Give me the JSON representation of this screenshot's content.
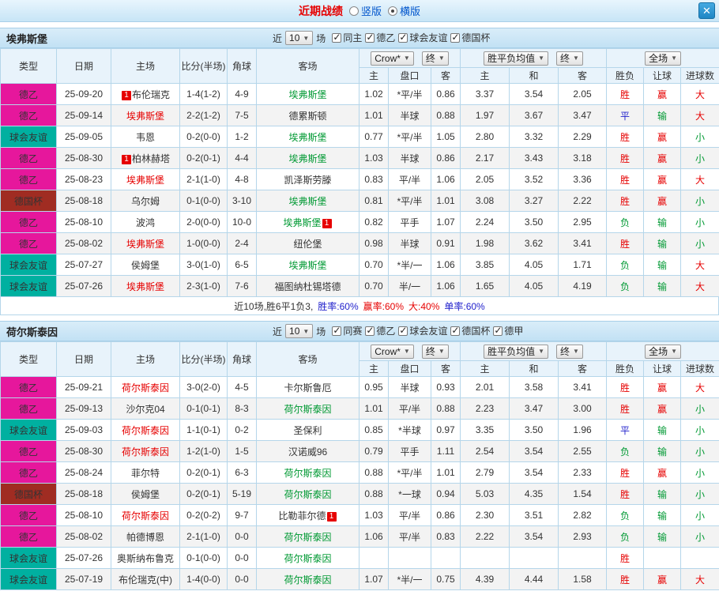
{
  "topbar": {
    "title": "近期战绩",
    "options": [
      {
        "label": "竖版",
        "selected": false
      },
      {
        "label": "横版",
        "selected": true
      }
    ],
    "close": "✕"
  },
  "filters": {
    "near": "近",
    "count": "10",
    "unit": "场",
    "company": "Crow*",
    "final": "终",
    "avg": "胜平负均值",
    "scope": "全场"
  },
  "table_header": {
    "type": "类型",
    "date": "日期",
    "home": "主场",
    "score": "比分(半场)",
    "corner": "角球",
    "away": "客场",
    "odds_home": "主",
    "odds_handicap": "盘口",
    "odds_away": "客",
    "avg_home": "主",
    "avg_draw": "和",
    "avg_away": "客",
    "result": "胜负",
    "handicap": "让球",
    "goals": "进球数"
  },
  "league_colors": {
    "德乙": "#e6179c",
    "球会友谊": "#00b0a0",
    "德国杯": "#a02c22"
  },
  "result_colors": {
    "red": "#e60000",
    "green": "#009933",
    "blue": "#2222cc"
  },
  "sections": [
    {
      "team": "埃弗斯堡",
      "checkboxes": [
        {
          "label": "同主",
          "checked": true
        },
        {
          "label": "德乙",
          "checked": true
        },
        {
          "label": "球会友谊",
          "checked": true
        },
        {
          "label": "德国杯",
          "checked": true
        }
      ],
      "rows": [
        {
          "league": "德乙",
          "date": "25-09-20",
          "home": {
            "name": "布伦瑞克",
            "badge": "1",
            "badge_pos": "before"
          },
          "score": "1-4(1-2)",
          "corner": "4-9",
          "away": {
            "name": "埃弗斯堡",
            "cls": "green"
          },
          "odds": [
            "1.02",
            "*平/半",
            "0.86",
            "3.37",
            "3.54",
            "2.05"
          ],
          "results": [
            {
              "t": "胜",
              "c": "red"
            },
            {
              "t": "赢",
              "c": "red"
            },
            {
              "t": "大",
              "c": "red"
            }
          ]
        },
        {
          "league": "德乙",
          "date": "25-09-14",
          "home": {
            "name": "埃弗斯堡",
            "cls": "red"
          },
          "score": "2-2(1-2)",
          "corner": "7-5",
          "away": {
            "name": "德累斯顿"
          },
          "odds": [
            "1.01",
            "半球",
            "0.88",
            "1.97",
            "3.67",
            "3.47"
          ],
          "results": [
            {
              "t": "平",
              "c": "blue"
            },
            {
              "t": "输",
              "c": "green"
            },
            {
              "t": "大",
              "c": "red"
            }
          ]
        },
        {
          "league": "球会友谊",
          "date": "25-09-05",
          "home": {
            "name": "韦恩"
          },
          "score": "0-2(0-0)",
          "corner": "1-2",
          "away": {
            "name": "埃弗斯堡",
            "cls": "green"
          },
          "odds": [
            "0.77",
            "*平/半",
            "1.05",
            "2.80",
            "3.32",
            "2.29"
          ],
          "results": [
            {
              "t": "胜",
              "c": "red"
            },
            {
              "t": "赢",
              "c": "red"
            },
            {
              "t": "小",
              "c": "green"
            }
          ]
        },
        {
          "league": "德乙",
          "date": "25-08-30",
          "home": {
            "name": "柏林赫塔",
            "badge": "1",
            "badge_pos": "before"
          },
          "score": "0-2(0-1)",
          "corner": "4-4",
          "away": {
            "name": "埃弗斯堡",
            "cls": "green"
          },
          "odds": [
            "1.03",
            "半球",
            "0.86",
            "2.17",
            "3.43",
            "3.18"
          ],
          "results": [
            {
              "t": "胜",
              "c": "red"
            },
            {
              "t": "赢",
              "c": "red"
            },
            {
              "t": "小",
              "c": "green"
            }
          ]
        },
        {
          "league": "德乙",
          "date": "25-08-23",
          "home": {
            "name": "埃弗斯堡",
            "cls": "red"
          },
          "score": "2-1(1-0)",
          "corner": "4-8",
          "away": {
            "name": "凯泽斯劳滕"
          },
          "odds": [
            "0.83",
            "平/半",
            "1.06",
            "2.05",
            "3.52",
            "3.36"
          ],
          "results": [
            {
              "t": "胜",
              "c": "red"
            },
            {
              "t": "赢",
              "c": "red"
            },
            {
              "t": "大",
              "c": "red"
            }
          ]
        },
        {
          "league": "德国杯",
          "date": "25-08-18",
          "home": {
            "name": "乌尔姆"
          },
          "score": "0-1(0-0)",
          "corner": "3-10",
          "away": {
            "name": "埃弗斯堡",
            "cls": "green"
          },
          "odds": [
            "0.81",
            "*平/半",
            "1.01",
            "3.08",
            "3.27",
            "2.22"
          ],
          "results": [
            {
              "t": "胜",
              "c": "red"
            },
            {
              "t": "赢",
              "c": "red"
            },
            {
              "t": "小",
              "c": "green"
            }
          ]
        },
        {
          "league": "德乙",
          "date": "25-08-10",
          "home": {
            "name": "波鸿"
          },
          "score": "2-0(0-0)",
          "corner": "10-0",
          "away": {
            "name": "埃弗斯堡",
            "cls": "green",
            "badge": "1",
            "badge_pos": "after"
          },
          "odds": [
            "0.82",
            "平手",
            "1.07",
            "2.24",
            "3.50",
            "2.95"
          ],
          "results": [
            {
              "t": "负",
              "c": "green"
            },
            {
              "t": "输",
              "c": "green"
            },
            {
              "t": "小",
              "c": "green"
            }
          ]
        },
        {
          "league": "德乙",
          "date": "25-08-02",
          "home": {
            "name": "埃弗斯堡",
            "cls": "red"
          },
          "score": "1-0(0-0)",
          "corner": "2-4",
          "away": {
            "name": "纽伦堡"
          },
          "odds": [
            "0.98",
            "半球",
            "0.91",
            "1.98",
            "3.62",
            "3.41"
          ],
          "results": [
            {
              "t": "胜",
              "c": "red"
            },
            {
              "t": "输",
              "c": "green"
            },
            {
              "t": "小",
              "c": "green"
            }
          ]
        },
        {
          "league": "球会友谊",
          "date": "25-07-27",
          "home": {
            "name": "侯姆堡"
          },
          "score": "3-0(1-0)",
          "corner": "6-5",
          "away": {
            "name": "埃弗斯堡",
            "cls": "green"
          },
          "odds": [
            "0.70",
            "*半/一",
            "1.06",
            "3.85",
            "4.05",
            "1.71"
          ],
          "results": [
            {
              "t": "负",
              "c": "green"
            },
            {
              "t": "输",
              "c": "green"
            },
            {
              "t": "大",
              "c": "red"
            }
          ]
        },
        {
          "league": "球会友谊",
          "date": "25-07-26",
          "home": {
            "name": "埃弗斯堡",
            "cls": "red"
          },
          "score": "2-3(1-0)",
          "corner": "7-6",
          "away": {
            "name": "福图纳杜锡塔德"
          },
          "odds": [
            "0.70",
            "半/一",
            "1.06",
            "1.65",
            "4.05",
            "4.19"
          ],
          "results": [
            {
              "t": "负",
              "c": "green"
            },
            {
              "t": "输",
              "c": "green"
            },
            {
              "t": "大",
              "c": "red"
            }
          ]
        }
      ],
      "summary": [
        {
          "t": "近10场,胜6平1负3,",
          "c": "#333333"
        },
        {
          "t": "胜率:60%",
          "c": "#2222cc"
        },
        {
          "t": "赢率:60%",
          "c": "#e60000"
        },
        {
          "t": "大:40%",
          "c": "#e60000"
        },
        {
          "t": "单率:60%",
          "c": "#2222cc"
        }
      ]
    },
    {
      "team": "荷尔斯泰因",
      "checkboxes": [
        {
          "label": "同赛",
          "checked": true
        },
        {
          "label": "德乙",
          "checked": true
        },
        {
          "label": "球会友谊",
          "checked": true
        },
        {
          "label": "德国杯",
          "checked": true
        },
        {
          "label": "德甲",
          "checked": true
        }
      ],
      "rows": [
        {
          "league": "德乙",
          "date": "25-09-21",
          "home": {
            "name": "荷尔斯泰因",
            "cls": "red"
          },
          "score": "3-0(2-0)",
          "corner": "4-5",
          "away": {
            "name": "卡尔斯鲁厄"
          },
          "odds": [
            "0.95",
            "半球",
            "0.93",
            "2.01",
            "3.58",
            "3.41"
          ],
          "results": [
            {
              "t": "胜",
              "c": "red"
            },
            {
              "t": "赢",
              "c": "red"
            },
            {
              "t": "大",
              "c": "red"
            }
          ]
        },
        {
          "league": "德乙",
          "date": "25-09-13",
          "home": {
            "name": "沙尔克04"
          },
          "score": "0-1(0-1)",
          "corner": "8-3",
          "away": {
            "name": "荷尔斯泰因",
            "cls": "green"
          },
          "odds": [
            "1.01",
            "平/半",
            "0.88",
            "2.23",
            "3.47",
            "3.00"
          ],
          "results": [
            {
              "t": "胜",
              "c": "red"
            },
            {
              "t": "赢",
              "c": "red"
            },
            {
              "t": "小",
              "c": "green"
            }
          ]
        },
        {
          "league": "球会友谊",
          "date": "25-09-03",
          "home": {
            "name": "荷尔斯泰因",
            "cls": "red"
          },
          "score": "1-1(0-1)",
          "corner": "0-2",
          "away": {
            "name": "圣保利"
          },
          "odds": [
            "0.85",
            "*半球",
            "0.97",
            "3.35",
            "3.50",
            "1.96"
          ],
          "results": [
            {
              "t": "平",
              "c": "blue"
            },
            {
              "t": "输",
              "c": "green"
            },
            {
              "t": "小",
              "c": "green"
            }
          ]
        },
        {
          "league": "德乙",
          "date": "25-08-30",
          "home": {
            "name": "荷尔斯泰因",
            "cls": "red"
          },
          "score": "1-2(1-0)",
          "corner": "1-5",
          "away": {
            "name": "汉诺威96"
          },
          "odds": [
            "0.79",
            "平手",
            "1.11",
            "2.54",
            "3.54",
            "2.55"
          ],
          "results": [
            {
              "t": "负",
              "c": "green"
            },
            {
              "t": "输",
              "c": "green"
            },
            {
              "t": "小",
              "c": "green"
            }
          ]
        },
        {
          "league": "德乙",
          "date": "25-08-24",
          "home": {
            "name": "菲尔特"
          },
          "score": "0-2(0-1)",
          "corner": "6-3",
          "away": {
            "name": "荷尔斯泰因",
            "cls": "green"
          },
          "odds": [
            "0.88",
            "*平/半",
            "1.01",
            "2.79",
            "3.54",
            "2.33"
          ],
          "results": [
            {
              "t": "胜",
              "c": "red"
            },
            {
              "t": "赢",
              "c": "red"
            },
            {
              "t": "小",
              "c": "green"
            }
          ]
        },
        {
          "league": "德国杯",
          "date": "25-08-18",
          "home": {
            "name": "侯姆堡"
          },
          "score": "0-2(0-1)",
          "corner": "5-19",
          "away": {
            "name": "荷尔斯泰因",
            "cls": "green"
          },
          "odds": [
            "0.88",
            "*一球",
            "0.94",
            "5.03",
            "4.35",
            "1.54"
          ],
          "results": [
            {
              "t": "胜",
              "c": "red"
            },
            {
              "t": "输",
              "c": "green"
            },
            {
              "t": "小",
              "c": "green"
            }
          ]
        },
        {
          "league": "德乙",
          "date": "25-08-10",
          "home": {
            "name": "荷尔斯泰因",
            "cls": "red"
          },
          "score": "0-2(0-2)",
          "corner": "9-7",
          "away": {
            "name": "比勒菲尔德",
            "badge": "1",
            "badge_pos": "after"
          },
          "odds": [
            "1.03",
            "平/半",
            "0.86",
            "2.30",
            "3.51",
            "2.82"
          ],
          "results": [
            {
              "t": "负",
              "c": "green"
            },
            {
              "t": "输",
              "c": "green"
            },
            {
              "t": "小",
              "c": "green"
            }
          ]
        },
        {
          "league": "德乙",
          "date": "25-08-02",
          "home": {
            "name": "帕德博恩"
          },
          "score": "2-1(1-0)",
          "corner": "0-0",
          "away": {
            "name": "荷尔斯泰因",
            "cls": "green"
          },
          "odds": [
            "1.06",
            "平/半",
            "0.83",
            "2.22",
            "3.54",
            "2.93"
          ],
          "results": [
            {
              "t": "负",
              "c": "green"
            },
            {
              "t": "输",
              "c": "green"
            },
            {
              "t": "小",
              "c": "green"
            }
          ]
        },
        {
          "league": "球会友谊",
          "date": "25-07-26",
          "home": {
            "name": "奥斯纳布鲁克"
          },
          "score": "0-1(0-0)",
          "corner": "0-0",
          "away": {
            "name": "荷尔斯泰因",
            "cls": "green"
          },
          "odds": [
            "",
            "",
            "",
            "",
            "",
            ""
          ],
          "results": [
            {
              "t": "胜",
              "c": "red"
            },
            {
              "t": "",
              "c": ""
            },
            {
              "t": "",
              "c": ""
            }
          ]
        },
        {
          "league": "球会友谊",
          "date": "25-07-19",
          "home": {
            "name": "布伦瑞克(中)"
          },
          "score": "1-4(0-0)",
          "corner": "0-0",
          "away": {
            "name": "荷尔斯泰因",
            "cls": "green"
          },
          "odds": [
            "1.07",
            "*半/一",
            "0.75",
            "4.39",
            "4.44",
            "1.58"
          ],
          "results": [
            {
              "t": "胜",
              "c": "red"
            },
            {
              "t": "赢",
              "c": "red"
            },
            {
              "t": "大",
              "c": "red"
            }
          ]
        }
      ]
    }
  ]
}
